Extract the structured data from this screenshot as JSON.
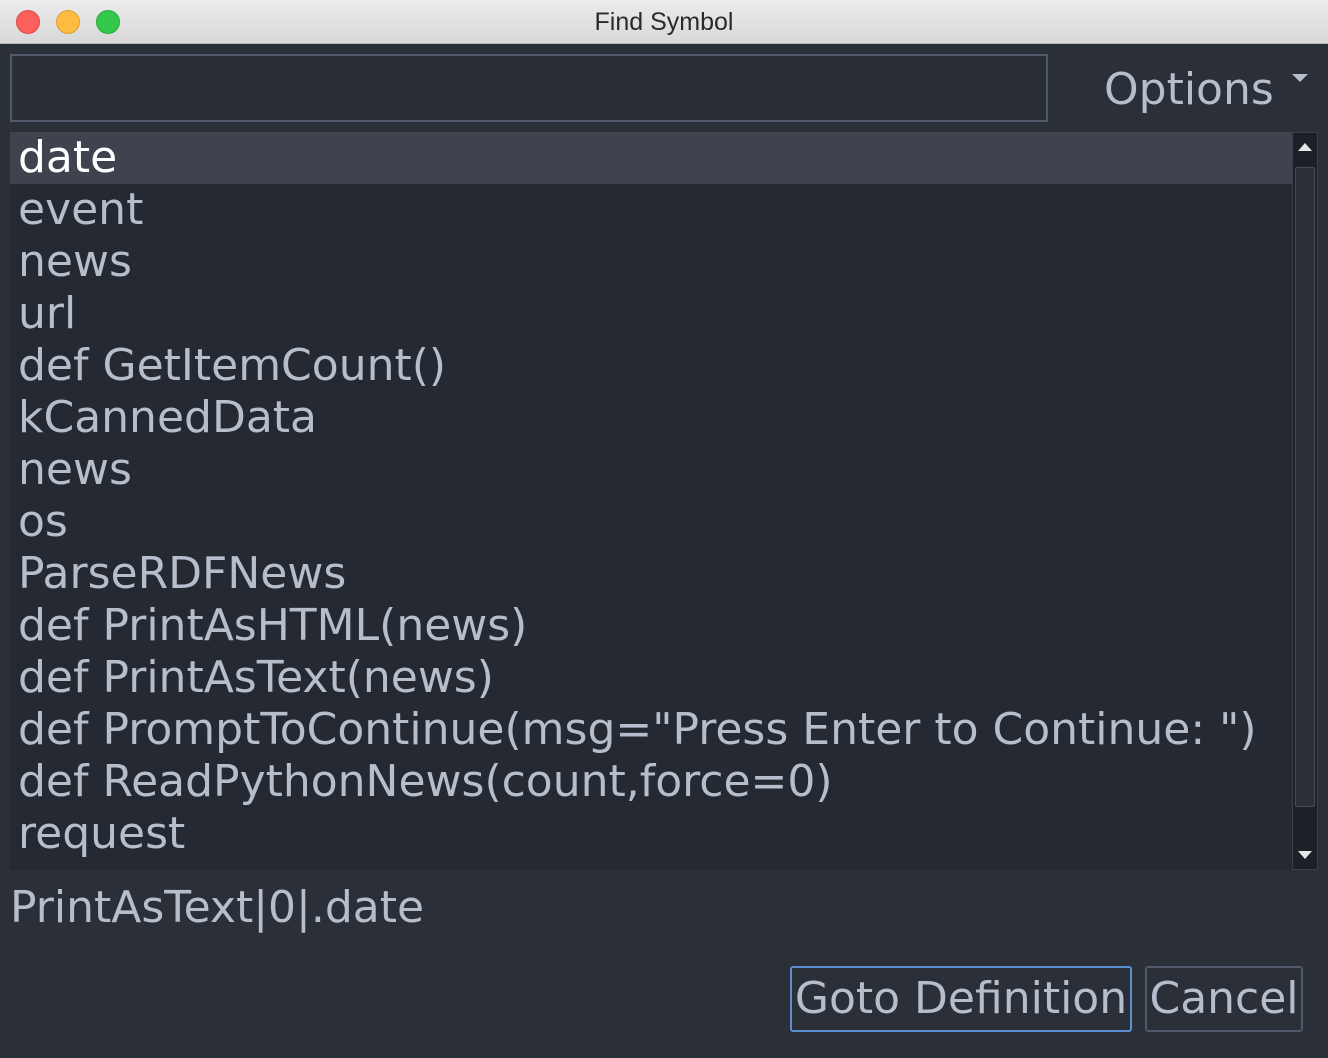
{
  "window": {
    "title": "Find Symbol"
  },
  "search": {
    "value": "",
    "placeholder": ""
  },
  "options": {
    "label": "Options"
  },
  "results": [
    "date",
    "event",
    "news",
    "url",
    "def GetItemCount()",
    "kCannedData",
    "news",
    "os",
    "ParseRDFNews",
    "def PrintAsHTML(news)",
    "def PrintAsText(news)",
    "def PromptToContinue(msg=\"Press Enter to Continue: \")",
    "def ReadPythonNews(count,force=0)",
    "request"
  ],
  "selected_index": 0,
  "status": {
    "path": "PrintAsText|0|.date"
  },
  "buttons": {
    "goto_label": "Goto Definition",
    "cancel_label": "Cancel"
  },
  "colors": {
    "background": "#2b2f38",
    "list_background": "#252932",
    "selected_row": "#3e434e",
    "text": "#b6becc",
    "focus_border": "#5b8fd0"
  }
}
